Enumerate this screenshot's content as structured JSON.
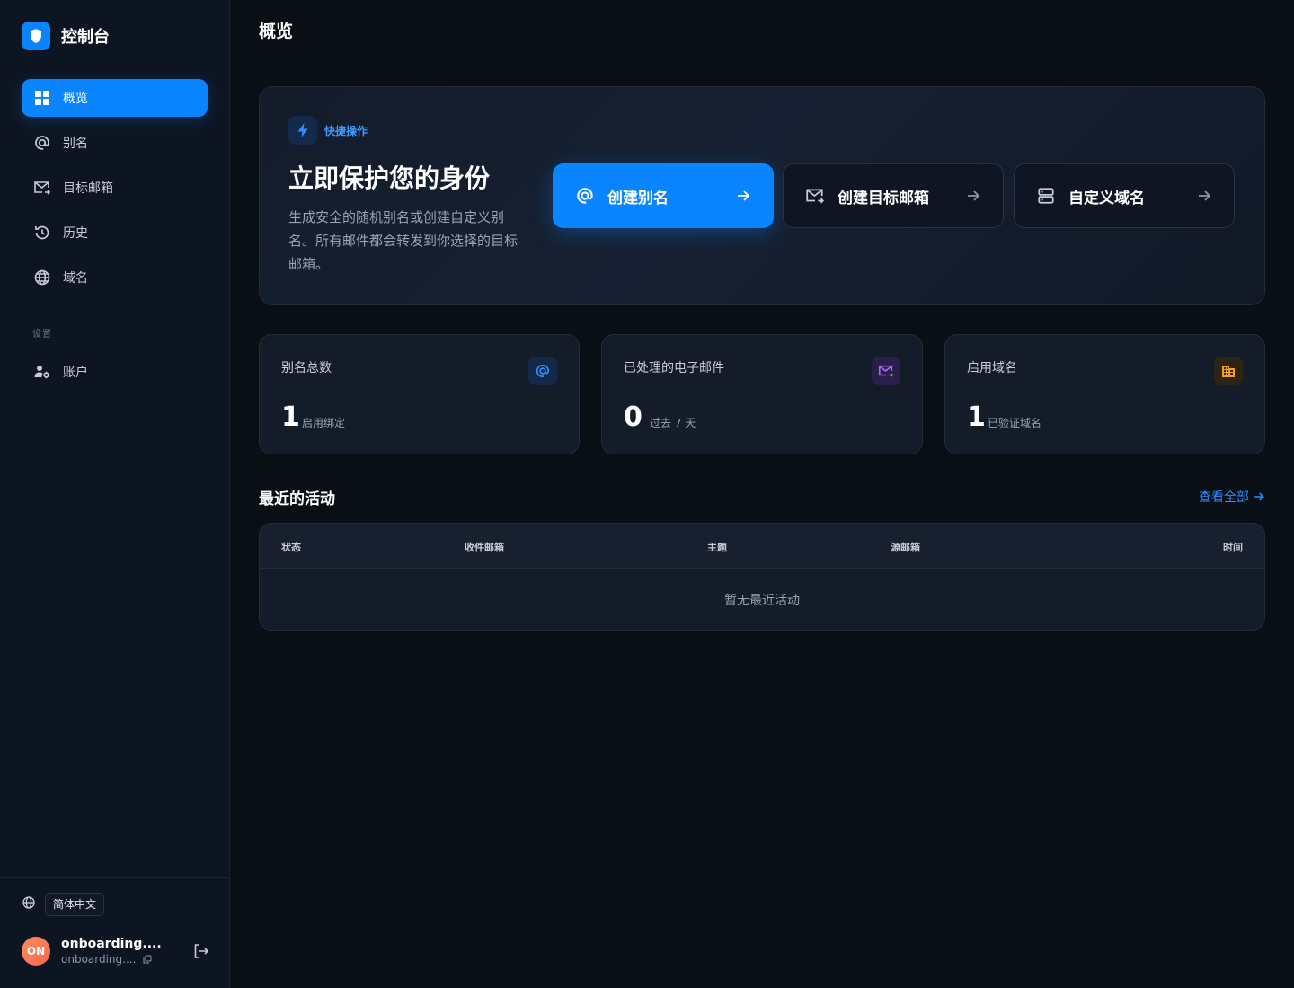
{
  "brand": {
    "title": "控制台",
    "logo_icon": "shield-icon",
    "accent": "#0a84ff"
  },
  "sidebar": {
    "items": [
      {
        "label": "概览",
        "icon": "grid-icon",
        "active": true
      },
      {
        "label": "别名",
        "icon": "at-icon",
        "active": false
      },
      {
        "label": "目标邮箱",
        "icon": "mail-forward-icon",
        "active": false
      },
      {
        "label": "历史",
        "icon": "history-icon",
        "active": false
      },
      {
        "label": "域名",
        "icon": "globe-icon",
        "active": false
      }
    ],
    "section_label": "设置",
    "settings_items": [
      {
        "label": "账户",
        "icon": "user-gear-icon"
      }
    ],
    "language": "简体中文",
    "user": {
      "initials": "ON",
      "name": "onboarding....",
      "email": "onboarding...."
    }
  },
  "header": {
    "title": "概览"
  },
  "hero": {
    "badge": "快捷操作",
    "title": "立即保护您的身份",
    "description": "生成安全的随机别名或创建自定义别名。所有邮件都会转发到你选择的目标邮箱。",
    "actions": [
      {
        "label": "创建别名",
        "icon": "at-icon",
        "primary": true
      },
      {
        "label": "创建目标邮箱",
        "icon": "mail-forward-icon",
        "primary": false
      },
      {
        "label": "自定义域名",
        "icon": "server-icon",
        "primary": false
      }
    ]
  },
  "stats": [
    {
      "label": "别名总数",
      "value": "1",
      "sub": "启用绑定",
      "icon": "at-icon",
      "color": "#2f8fff"
    },
    {
      "label": "已处理的电子邮件",
      "value": "0",
      "sub": "过去 7 天",
      "icon": "mail-forward-icon",
      "color": "#b26bff"
    },
    {
      "label": "启用域名",
      "value": "1",
      "sub": "已验证域名",
      "icon": "building-icon",
      "color": "#f0a020"
    }
  ],
  "activity": {
    "title": "最近的活动",
    "view_all": "查看全部",
    "columns": [
      "状态",
      "收件邮箱",
      "主题",
      "源邮箱",
      "时间"
    ],
    "empty_text": "暂无最近活动"
  }
}
